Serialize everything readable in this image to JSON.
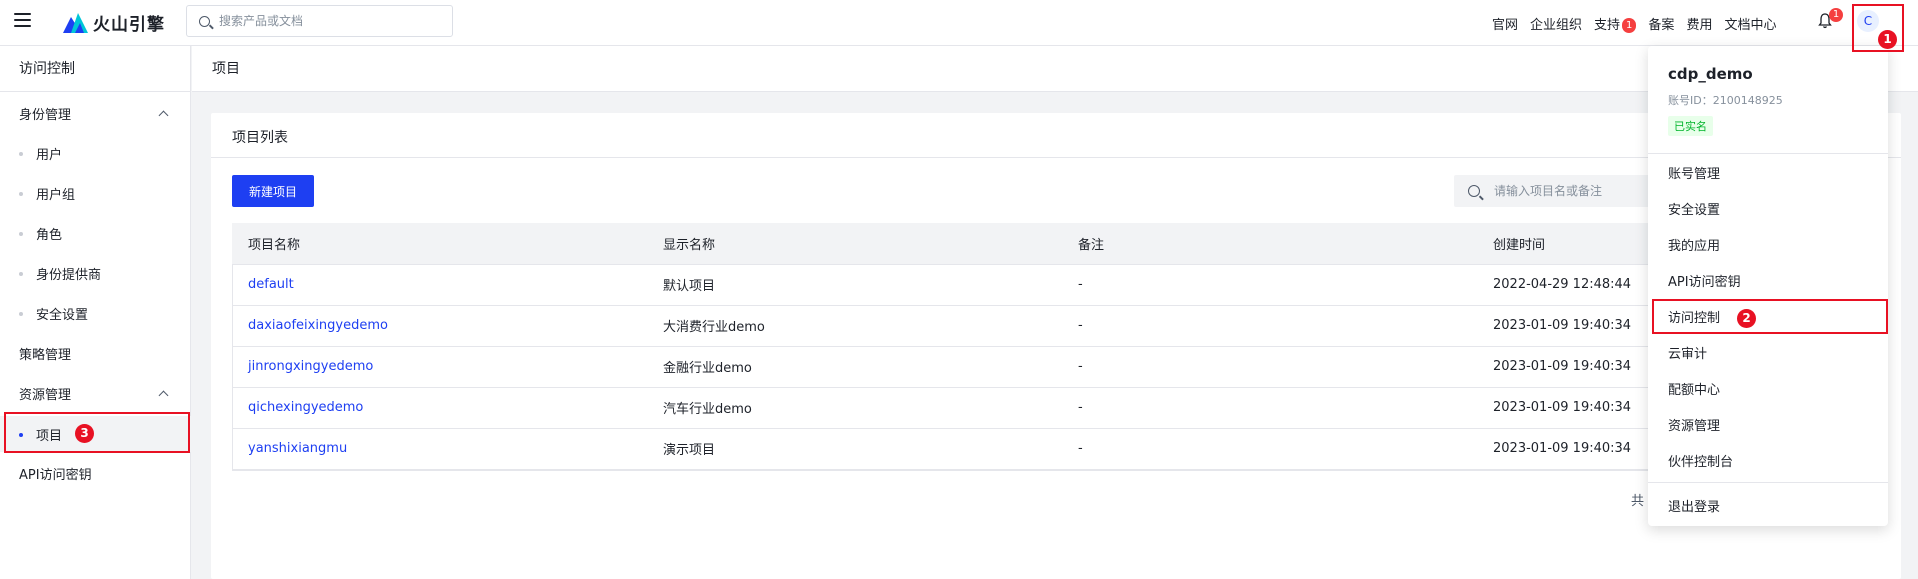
{
  "topbar": {
    "brand": "火山引擎",
    "search_placeholder": "搜索产品或文档",
    "nav": [
      "官网",
      "企业组织",
      "支持",
      "备案",
      "费用",
      "文档中心"
    ],
    "support_badge": "1",
    "bell_badge": "1",
    "avatar_initial": "C"
  },
  "annotations": [
    "1",
    "2",
    "3"
  ],
  "sidebar": {
    "title": "访问控制",
    "groups": {
      "identity": "身份管理",
      "policy": "策略管理",
      "resource": "资源管理",
      "apikey": "API访问密钥"
    },
    "identity_items": [
      "用户",
      "用户组",
      "角色",
      "身份提供商",
      "安全设置"
    ],
    "resource_items": [
      "项目"
    ]
  },
  "breadcrumb": "项目",
  "card": {
    "title": "项目列表",
    "new_button": "新建项目",
    "search_placeholder": "请输入项目名或备注",
    "columns": [
      "项目名称",
      "显示名称",
      "备注",
      "创建时间"
    ],
    "rows": [
      [
        "default",
        "默认项目",
        "-",
        "2022-04-29 12:48:44"
      ],
      [
        "daxiaofeixingyedemo",
        "大消费行业demo",
        "-",
        "2023-01-09 19:40:34"
      ],
      [
        "jinrongxingyedemo",
        "金融行业demo",
        "-",
        "2023-01-09 19:40:34"
      ],
      [
        "qichexingyedemo",
        "汽车行业demo",
        "-",
        "2023-01-09 19:40:34"
      ],
      [
        "yanshixiangmu",
        "演示项目",
        "-",
        "2023-01-09 19:40:34"
      ]
    ],
    "total_prefix": "共"
  },
  "dropdown": {
    "username": "cdp_demo",
    "account_id": "账号ID：2100148925",
    "verified": "已实名",
    "items": [
      "账号管理",
      "安全设置",
      "我的应用",
      "API访问密钥",
      "访问控制",
      "云审计",
      "配额中心",
      "资源管理",
      "伙伴控制台"
    ],
    "logout": "退出登录"
  },
  "colors": {
    "primary": "#1e3ff2",
    "annotation": "#e81123"
  }
}
